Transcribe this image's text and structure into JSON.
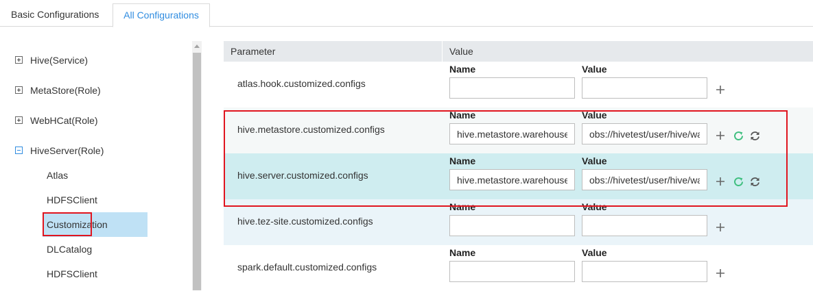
{
  "tabs": [
    {
      "label": "Basic Configurations",
      "active": false
    },
    {
      "label": "All Configurations",
      "active": true
    }
  ],
  "tree": {
    "groups": [
      {
        "label": "Hive(Service)",
        "expanded": false
      },
      {
        "label": "MetaStore(Role)",
        "expanded": false
      },
      {
        "label": "WebHCat(Role)",
        "expanded": false
      },
      {
        "label": "HiveServer(Role)",
        "expanded": true
      }
    ],
    "children": [
      {
        "label": "Atlas"
      },
      {
        "label": "HDFSClient"
      },
      {
        "label": "Customization",
        "selected": true
      },
      {
        "label": "DLCatalog"
      },
      {
        "label": "HDFSClient"
      }
    ]
  },
  "table": {
    "header": {
      "parameter": "Parameter",
      "value": "Value"
    },
    "name_label": "Name",
    "value_label": "Value",
    "rows": [
      {
        "parameter": "atlas.hook.customized.configs",
        "name": "",
        "value": ""
      },
      {
        "parameter": "hive.metastore.customized.configs",
        "name": "hive.metastore.warehouse",
        "value": "obs://hivetest/user/hive/wa"
      },
      {
        "parameter": "hive.server.customized.configs",
        "name": "hive.metastore.warehouse",
        "value": "obs://hivetest/user/hive/wa"
      },
      {
        "parameter": "hive.tez-site.customized.configs",
        "name": "",
        "value": ""
      },
      {
        "parameter": "spark.default.customized.configs",
        "name": "",
        "value": ""
      }
    ]
  },
  "icons": {
    "add": "plus-icon",
    "refresh": "refresh-icon",
    "sync": "sync-icon"
  },
  "colors": {
    "accent": "#2f8ce0",
    "selected_bg": "#bfe1f5",
    "highlight_row": "#cfedf0",
    "annotation_red": "#e0141e",
    "refresh_green": "#3fbf7f"
  }
}
